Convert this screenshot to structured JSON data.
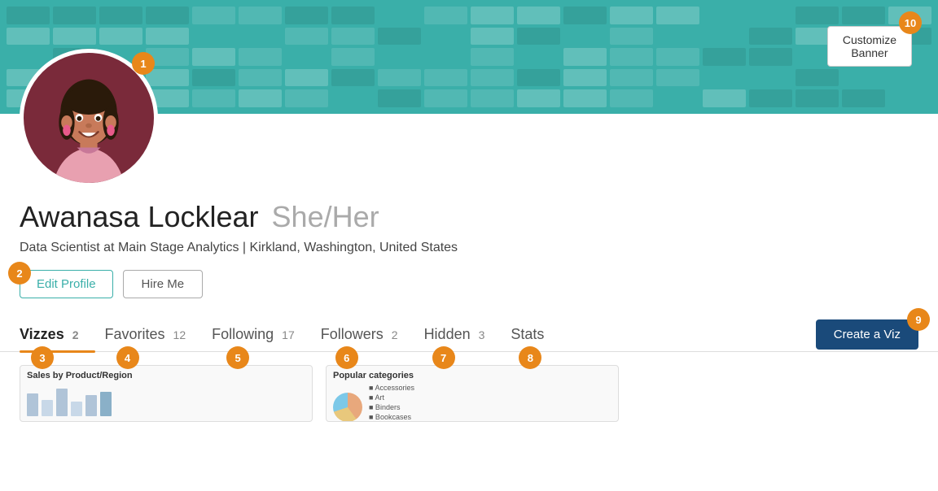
{
  "banner": {
    "customize_label": "Customize Banner",
    "bg_color": "#3aafa9"
  },
  "profile": {
    "name": "Awanasa Locklear",
    "pronouns": "She/Her",
    "bio": "Data Scientist at Main Stage Analytics | Kirkland, Washington, United States"
  },
  "buttons": {
    "edit_profile": "Edit Profile",
    "hire_me": "Hire Me",
    "create_viz": "Create a Viz"
  },
  "tabs": [
    {
      "label": "Vizzes",
      "count": "2",
      "active": true,
      "badge": "3"
    },
    {
      "label": "Favorites",
      "count": "12",
      "active": false,
      "badge": "4"
    },
    {
      "label": "Following",
      "count": "17",
      "active": false,
      "badge": "5"
    },
    {
      "label": "Followers",
      "count": "2",
      "active": false,
      "badge": "6"
    },
    {
      "label": "Hidden",
      "count": "3",
      "active": false,
      "badge": "7"
    },
    {
      "label": "Stats",
      "count": "",
      "active": false,
      "badge": "8"
    }
  ],
  "badges": {
    "avatar": "1",
    "edit_profile": "2",
    "create_viz": "9",
    "customize_banner": "10"
  },
  "vizzes": [
    {
      "title": "Sales by Product/Region"
    },
    {
      "title": "Popular categories"
    }
  ]
}
